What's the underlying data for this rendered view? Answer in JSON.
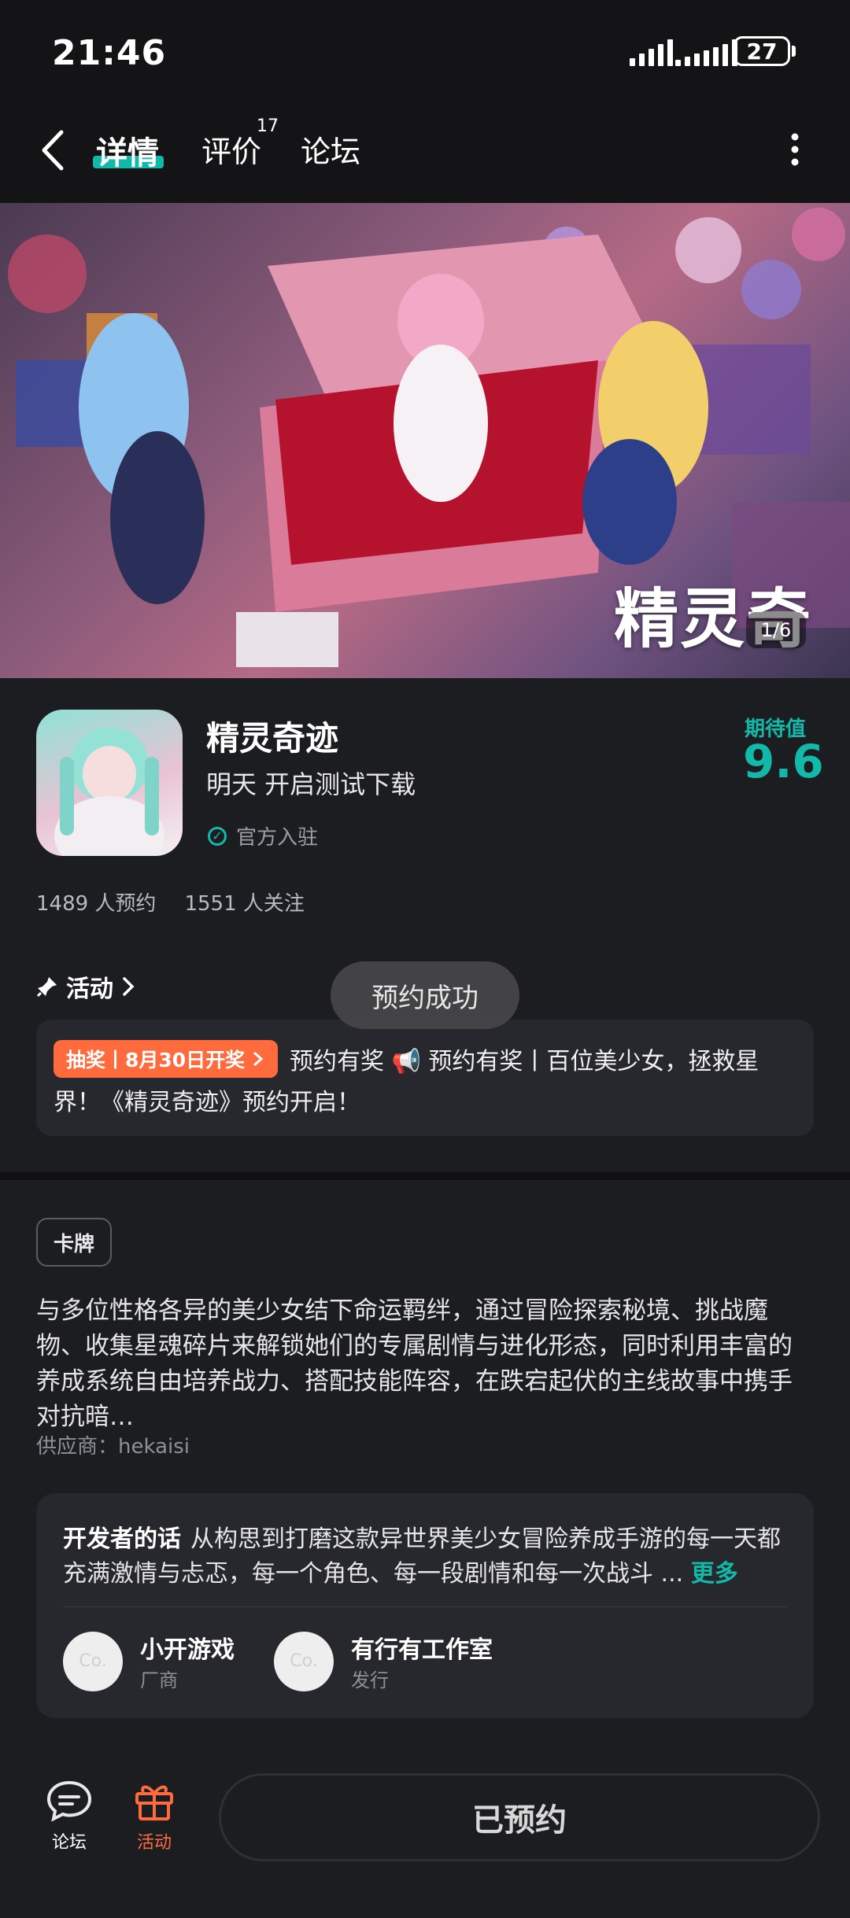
{
  "status_bar": {
    "time": "21:46",
    "battery": "27"
  },
  "header": {
    "tabs": [
      {
        "label": "详情",
        "active": true
      },
      {
        "label": "评价",
        "badge": "17"
      },
      {
        "label": "论坛"
      }
    ]
  },
  "banner": {
    "title": "精灵奇迹",
    "pager": "1/6"
  },
  "game": {
    "name": "精灵奇迹",
    "subtitle": "明天 开启测试下载",
    "official_label": "官方入驻",
    "expect_label": "期待值",
    "expect_value": "9.6",
    "reservations": "1489 人预约",
    "followers": "1551 人关注"
  },
  "activity": {
    "heading": "活动",
    "tag": "抽奖丨8月30日开奖",
    "line1": "预约有奖 📢 预约有奖丨百位美少女，拯救星",
    "line2": "界！《精灵奇迹》预约开启！"
  },
  "toast": "预约成功",
  "description": {
    "tag": "卡牌",
    "text": "与多位性格各异的美少女结下命运羁绊，通过冒险探索秘境、挑战魔物、收集星魂碎片来解锁她们的专属剧情与进化形态，同时利用丰富的养成系统自由培养战力、搭配技能阵容，在跌宕起伏的主线故事中携手对抗暗…",
    "supplier": "供应商：hekaisi"
  },
  "developer": {
    "title": "开发者的话",
    "text": "从构思到打磨这款异世界美少女冒险养成手游的每一天都充满激情与忐忑，每一个角色、每一段剧情和每一次战斗 ...",
    "more": "更多",
    "companies": [
      {
        "name": "小开游戏",
        "role": "厂商",
        "avatar": "Co."
      },
      {
        "name": "有行有工作室",
        "role": "发行",
        "avatar": "Co."
      }
    ]
  },
  "bottom": {
    "forum_label": "论坛",
    "activity_label": "活动",
    "booked_label": "已预约"
  },
  "colors": {
    "accent": "#13b9a8",
    "orange": "#ff6b3d",
    "background": "#1c1d21"
  }
}
